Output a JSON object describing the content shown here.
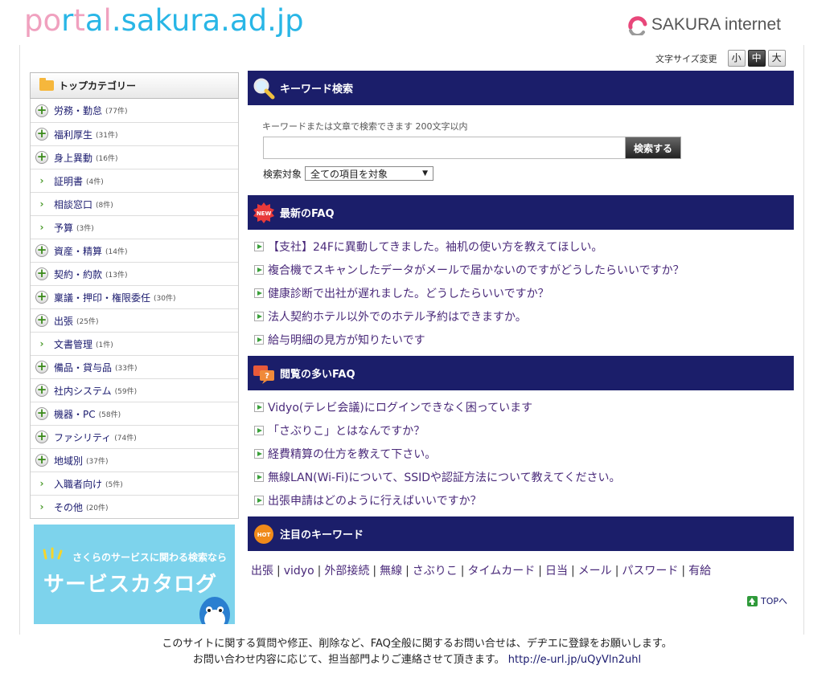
{
  "header": {
    "logo_part1": "po",
    "logo_part2": "r",
    "logo_part3": "t",
    "logo_part4": "a",
    "logo_part5": "l",
    "logo_part6": ".sakura.ad.jp",
    "brand": "SAKURA internet"
  },
  "font_size": {
    "label": "文字サイズ変更",
    "small": "小",
    "medium": "中",
    "large": "大"
  },
  "sidebar": {
    "title": "トップカテゴリー",
    "items": [
      {
        "label": "労務・勤怠",
        "count": "(77件)",
        "icon": "plus"
      },
      {
        "label": "福利厚生",
        "count": "(31件)",
        "icon": "plus"
      },
      {
        "label": "身上異動",
        "count": "(16件)",
        "icon": "plus"
      },
      {
        "label": "証明書",
        "count": "(4件)",
        "icon": "arrow"
      },
      {
        "label": "相談窓口",
        "count": "(8件)",
        "icon": "arrow"
      },
      {
        "label": "予算",
        "count": "(3件)",
        "icon": "arrow"
      },
      {
        "label": "資産・精算",
        "count": "(14件)",
        "icon": "plus"
      },
      {
        "label": "契約・約款",
        "count": "(13件)",
        "icon": "plus"
      },
      {
        "label": "稟議・押印・権限委任",
        "count": "(30件)",
        "icon": "plus"
      },
      {
        "label": "出張",
        "count": "(25件)",
        "icon": "plus"
      },
      {
        "label": "文書管理",
        "count": "(1件)",
        "icon": "arrow"
      },
      {
        "label": "備品・貸与品",
        "count": "(33件)",
        "icon": "plus"
      },
      {
        "label": "社内システム",
        "count": "(59件)",
        "icon": "plus"
      },
      {
        "label": "機器・PC",
        "count": "(58件)",
        "icon": "plus"
      },
      {
        "label": "ファシリティ",
        "count": "(74件)",
        "icon": "plus"
      },
      {
        "label": "地域別",
        "count": "(37件)",
        "icon": "plus"
      },
      {
        "label": "入職者向け",
        "count": "(5件)",
        "icon": "arrow"
      },
      {
        "label": "その他",
        "count": "(20件)",
        "icon": "arrow"
      }
    ],
    "banner": {
      "small_text": "さくらのサービスに関わる検索なら",
      "big_text": "サービスカタログ"
    }
  },
  "keyword_search": {
    "title": "キーワード検索",
    "hint": "キーワードまたは文章で検索できます 200文字以内",
    "input_value": "",
    "button": "検索する",
    "target_label": "検索対象",
    "target_selected": "全ての項目を対象"
  },
  "latest_faq": {
    "title": "最新のFAQ",
    "items": [
      "【支社】24Fに異動してきました。袖机の使い方を教えてほしい。",
      "複合機でスキャンしたデータがメールで届かないのですがどうしたらいいですか？",
      "健康診断で出社が遅れました。どうしたらいいですか？",
      "法人契約ホテル以外でのホテル予約はできますか。",
      "給与明細の見方が知りたいです"
    ]
  },
  "popular_faq": {
    "title": "閲覧の多いFAQ",
    "items": [
      "Vidyo(テレビ会議)にログインできなく困っています",
      "「さぶりこ」とはなんですか？",
      "経費精算の仕方を教えて下さい。",
      "無線LAN(Wi-Fi)について、SSIDや認証方法について教えてください。",
      "出張申請はどのように行えばいいですか？"
    ]
  },
  "hot_keywords": {
    "title": "注目のキーワード",
    "items": [
      "出張",
      "vidyo",
      "外部接続",
      "無線",
      "さぶりこ",
      "タイムカード",
      "日当",
      "メール",
      "パスワード",
      "有給"
    ]
  },
  "to_top": "TOPへ",
  "footer": {
    "line1": "このサイトに関する質問や修正、削除など、FAQ全般に関するお問い合せは、デヂエに登録をお願いします。",
    "line2": "お問い合わせ内容に応じて、担当部門よりご連絡させて頂きます。",
    "link": "http://e-url.jp/uQyVln2uhl"
  }
}
